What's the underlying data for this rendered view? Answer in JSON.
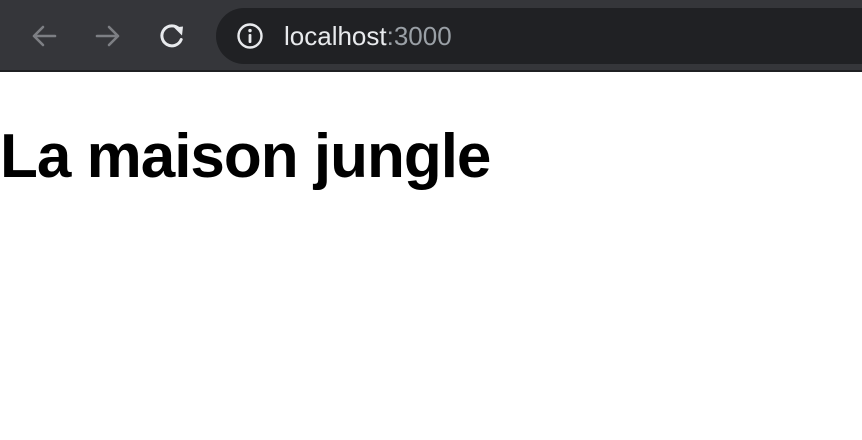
{
  "browser": {
    "address_bar": {
      "host": "localhost",
      "port": ":3000"
    },
    "icons": {
      "back": "arrow-left-icon",
      "forward": "arrow-right-icon",
      "reload": "reload-icon",
      "site_info": "info-icon"
    },
    "colors": {
      "toolbar": "#35363a",
      "omnibox": "#202124",
      "host_text": "#e8eaed",
      "port_text": "#9aa0a6"
    }
  },
  "page": {
    "title": "La maison jungle"
  }
}
